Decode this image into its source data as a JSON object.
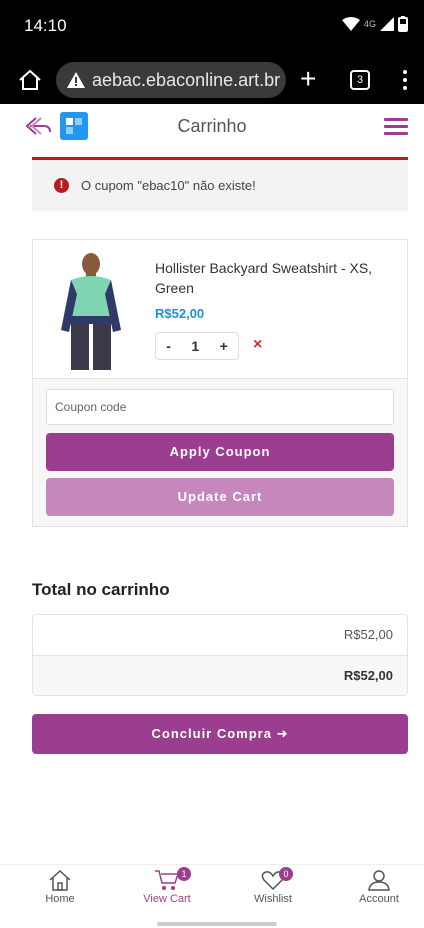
{
  "status_bar": {
    "time": "14:10",
    "network": "4G"
  },
  "browser": {
    "url": "aebac.ebaconline.art.br",
    "tabs_count": "3"
  },
  "header": {
    "title": "Carrinho"
  },
  "alert": {
    "message": "O cupom \"ebac10\" não existe!"
  },
  "cart_item": {
    "name": "Hollister Backyard Sweatshirt - XS, Green",
    "price": "R$52,00",
    "quantity": "1",
    "minus": "-",
    "plus": "+",
    "remove": "×"
  },
  "coupon": {
    "placeholder": "Coupon code",
    "apply_label": "Apply Coupon",
    "update_label": "Update Cart"
  },
  "totals": {
    "title": "Total no carrinho",
    "subtotal": "R$52,00",
    "total": "R$52,00"
  },
  "checkout": {
    "label": "Concluir Compra ➜"
  },
  "bottom_nav": {
    "items": [
      {
        "label": "Home"
      },
      {
        "label": "View Cart",
        "badge": "1"
      },
      {
        "label": "Wishlist",
        "badge": "0"
      },
      {
        "label": "Account"
      }
    ]
  },
  "colors": {
    "primary": "#9b3e8f",
    "primary_light": "#c587bc",
    "error": "#b81c23",
    "price": "#1e90d8"
  }
}
